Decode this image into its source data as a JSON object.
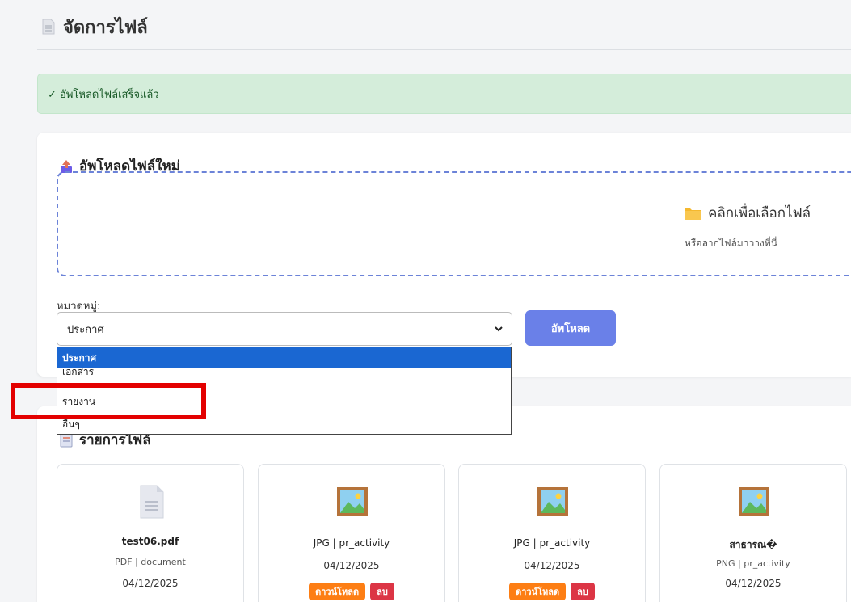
{
  "page": {
    "title": "จัดการไฟล์"
  },
  "alert": {
    "text": "✓ อัพโหลดไฟล์เสร็จแล้ว"
  },
  "upload": {
    "heading": "อัพโหลดไฟล์ใหม่",
    "dropzone_main": "คลิกเพื่อเลือกไฟล์",
    "dropzone_sub": "หรือลากไฟล์มาวางที่นี่",
    "category_label": "หมวดหมู่:",
    "selected_category": "ประกาศ",
    "button": "อัพโหลด"
  },
  "dropdown": {
    "options": [
      "ประกาศ",
      "เอกสาร",
      "รายงาน",
      "อื่นๆ"
    ],
    "selected_index": 0
  },
  "list": {
    "heading": "รายการไฟล์",
    "files": [
      {
        "name": "test06.pdf",
        "meta": "PDF | document",
        "date": "04/12/2025",
        "icon": "document-icon"
      },
      {
        "name": "",
        "meta": "JPG | pr_activity",
        "date": "04/12/2025",
        "icon": "image-icon",
        "download": "ดาวน์โหลด",
        "delete": "ลบ"
      },
      {
        "name": "",
        "meta": "JPG | pr_activity",
        "date": "04/12/2025",
        "icon": "image-icon",
        "download": "ดาวน์โหลด",
        "delete": "ลบ"
      },
      {
        "name": "สาธารณ�",
        "meta": "PNG | pr_activity",
        "date": "04/12/2025",
        "icon": "image-icon"
      }
    ]
  },
  "colors": {
    "accent": "#6a80e8",
    "success_bg": "#d4edda",
    "highlight": "#e30000",
    "select_blue": "#1a67d2"
  }
}
